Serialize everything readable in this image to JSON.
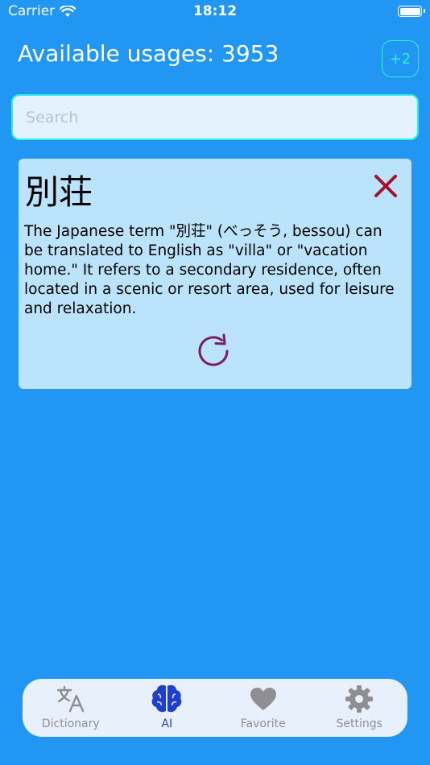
{
  "status_bar": {
    "carrier": "Carrier",
    "time": "18:12"
  },
  "header": {
    "usages_text": "Available usages: 3953",
    "plus_label": "+2"
  },
  "search": {
    "placeholder": "Search",
    "value": ""
  },
  "result": {
    "term": "別荘",
    "translation": "The Japanese term \"別荘\" (べっそう, bessou) can be translated to English as \"villa\" or \"vacation home.\" It refers to a secondary residence, often located in a scenic or resort area, used for leisure and relaxation."
  },
  "tabs": [
    {
      "label": "Dictionary",
      "icon": "translate-icon",
      "active": false
    },
    {
      "label": "AI",
      "icon": "brain-icon",
      "active": true
    },
    {
      "label": "Favorite",
      "icon": "heart-icon",
      "active": false
    },
    {
      "label": "Settings",
      "icon": "gear-icon",
      "active": false
    }
  ],
  "colors": {
    "background": "#2196F3",
    "accent": "#2EF2E0",
    "close": "#A3122B",
    "refresh": "#7A1E5E",
    "active_tab": "#1F3FCF",
    "inactive_tab": "#8E8E93"
  }
}
